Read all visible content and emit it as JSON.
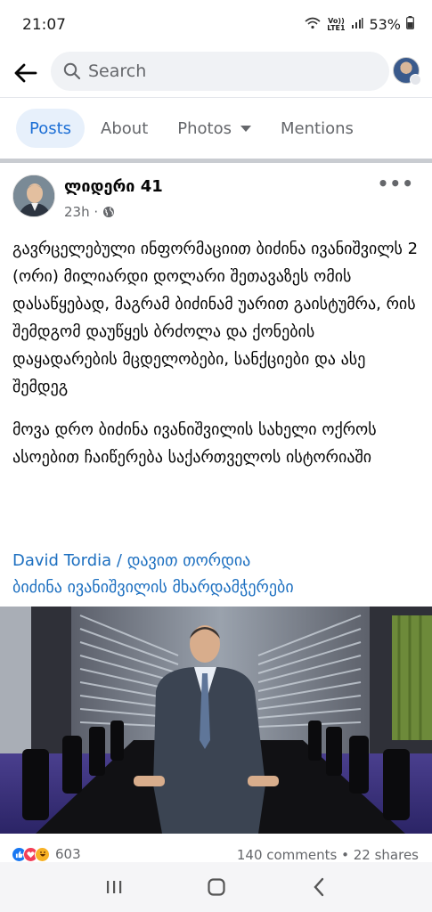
{
  "status": {
    "time": "21:07",
    "network": "Vo)) LTE1",
    "battery": "53%"
  },
  "search": {
    "placeholder": "Search"
  },
  "tabs": [
    {
      "label": "Posts",
      "active": true
    },
    {
      "label": "About",
      "active": false
    },
    {
      "label": "Photos",
      "active": false
    },
    {
      "label": "Mentions",
      "active": false
    }
  ],
  "post": {
    "author": "ლიდერი 41",
    "time": "23h ·",
    "paragraphs": [
      "გავრცელებული ინფორმაციით ბიძინა ივანიშვილს 2 (ორი) მილიარდი დოლარი შეთავაზეს ომის დასაწყებად, მაგრამ ბიძინამ უარით გაისტუმრა, რის შემდგომ დაუწყეს ბრძოლა და ქონების დაყადარების მცდელობები, სანქციები და ასე შემდეგ",
      "მოვა დრო ბიძინა ივანიშვილის სახელი ოქროს ასოებით ჩაიწერება საქართველოს ისტორიაში"
    ],
    "link_line1": "David Tordia / დავით თორდია",
    "link_line2": "ბიძინა ივანიშვილის მხარდამჭერები",
    "reaction_count": "603",
    "comments": "140 comments",
    "shares": "• 22 shares"
  },
  "icons": {
    "back": "arrow-left-icon",
    "search": "search-icon",
    "more": "more-horizontal-icon",
    "globe": "globe-icon"
  },
  "colors": {
    "accent": "#1b6ed5",
    "tab_active_bg": "#e7f0fb",
    "link": "#1c6fc0",
    "secondary_text": "#65676b"
  }
}
